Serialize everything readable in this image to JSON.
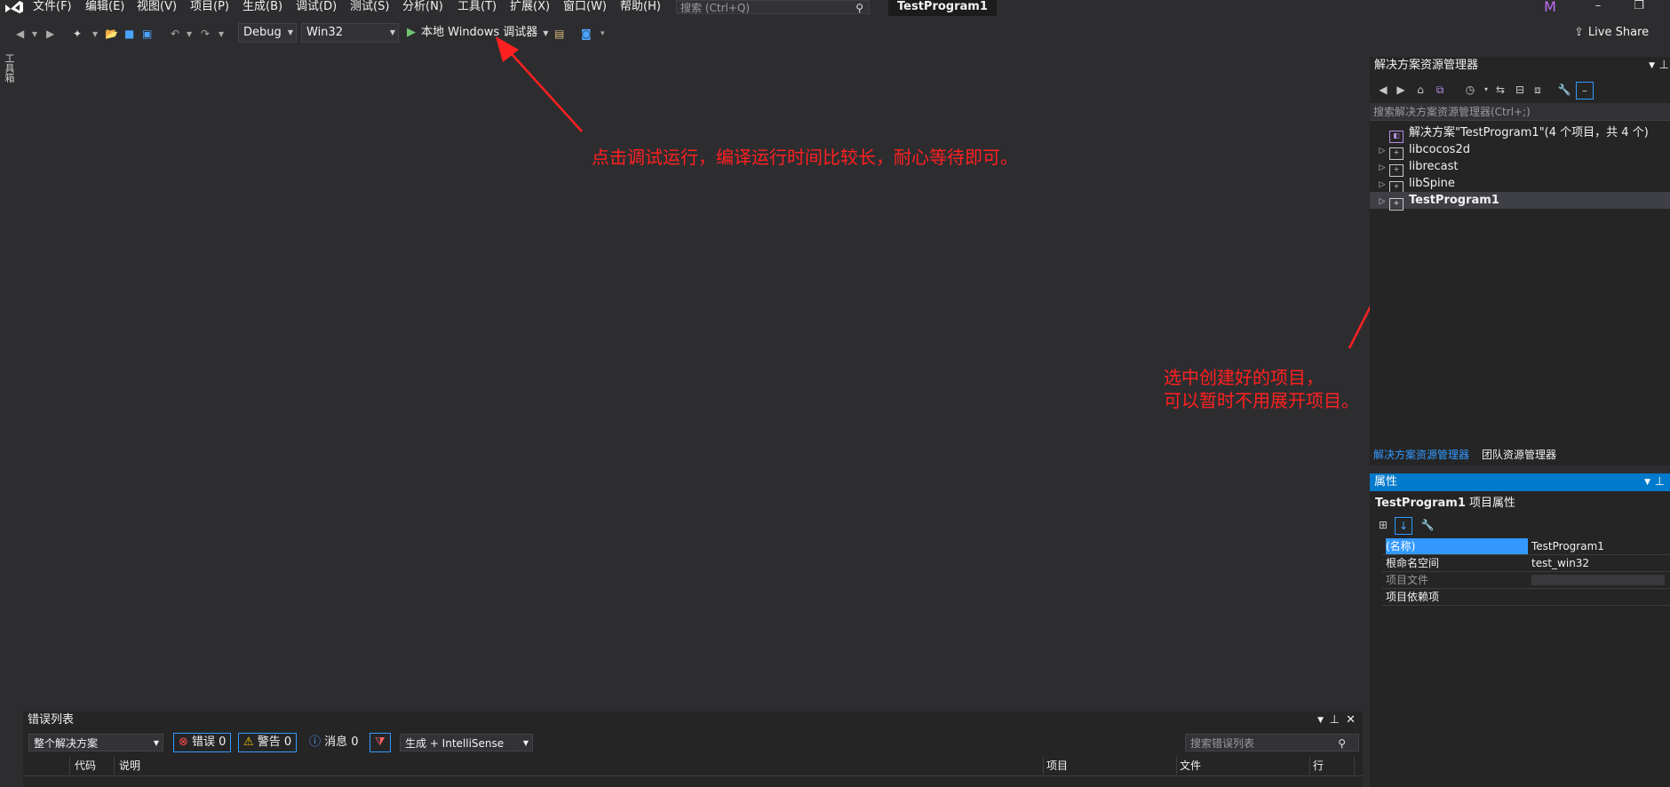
{
  "menu": {
    "items": [
      "文件(F)",
      "编辑(E)",
      "视图(V)",
      "项目(P)",
      "生成(B)",
      "调试(D)",
      "测试(S)",
      "分析(N)",
      "工具(T)",
      "扩展(X)",
      "窗口(W)",
      "帮助(H)"
    ],
    "search_placeholder": "搜索 (Ctrl+Q)",
    "window_title": "TestProgram1",
    "user_initial": "M"
  },
  "toolbar": {
    "config": "Debug",
    "platform": "Win32",
    "run_label": "本地 Windows 调试器",
    "live_share": "Live Share"
  },
  "toolbox_tab": "工具箱",
  "annotations": {
    "run_hint": "点击调试运行，编译运行时间比较长，耐心等待即可。",
    "select_hint_line1": "选中创建好的项目，",
    "select_hint_line2": "可以暂时不用展开项目。"
  },
  "solution_explorer": {
    "title": "解决方案资源管理器",
    "search_placeholder": "搜索解决方案资源管理器(Ctrl+;)",
    "solution_label": "解决方案\"TestProgram1\"(4 个项目，共 4 个)",
    "projects": [
      "libcocos2d",
      "librecast",
      "libSpine",
      "TestProgram1"
    ],
    "tab_active": "解决方案资源管理器",
    "tab_other": "团队资源管理器"
  },
  "properties": {
    "title": "属性",
    "object_name": "TestProgram1",
    "object_type": "项目属性",
    "rows": [
      {
        "key": "(名称)",
        "value": "TestProgram1"
      },
      {
        "key": "根命名空间",
        "value": "test_win32"
      },
      {
        "key": "项目文件",
        "value": ""
      },
      {
        "key": "项目依赖项",
        "value": ""
      }
    ]
  },
  "error_list": {
    "title": "错误列表",
    "scope": "整个解决方案",
    "errors_label": "错误 0",
    "warnings_label": "警告 0",
    "messages_label": "消息 0",
    "build_filter": "生成 + IntelliSense",
    "search_placeholder": "搜索错误列表",
    "columns": [
      "代码",
      "说明",
      "项目",
      "文件",
      "行"
    ]
  },
  "colors": {
    "accent": "#007acc",
    "annotation": "#ff2020",
    "background": "#2d2d30"
  }
}
